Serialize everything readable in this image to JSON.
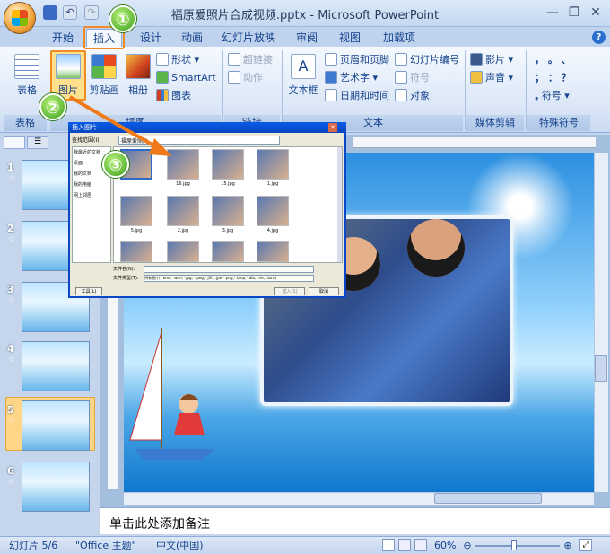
{
  "window": {
    "title": "福原爱照片合成视频.pptx - Microsoft PowerPoint",
    "min": "—",
    "max": "❐",
    "close": "✕"
  },
  "tabs": [
    "开始",
    "插入",
    "设计",
    "动画",
    "幻灯片放映",
    "审阅",
    "视图",
    "加载项"
  ],
  "ribbon": {
    "table": "表格",
    "picture": "图片",
    "clipart": "剪贴画",
    "album": "相册",
    "shapes": "形状",
    "smartart": "SmartArt",
    "chart": "图表",
    "hyperlink": "超链接",
    "action": "动作",
    "textbox": "文本框",
    "headerfooter": "页眉和页脚",
    "wordart": "艺术字",
    "datetime": "日期和时间",
    "slidenum": "幻灯片编号",
    "symbol": "符号",
    "object": "对象",
    "movie": "影片",
    "sound": "声音",
    "special_symbol": "符号",
    "punct1": "，  。  、",
    "punct2": "；  ：  ？",
    "groups": {
      "tables": "表格",
      "illustrations": "插图",
      "links": "链接",
      "text": "文本",
      "media": "媒体剪辑",
      "special": "特殊符号"
    }
  },
  "callouts": [
    "①",
    "②",
    "③"
  ],
  "dialog": {
    "title": "插入图片",
    "lookin_label": "查找范围(I):",
    "lookin_value": "福原爱照片",
    "places": [
      "我最近的文档",
      "桌面",
      "我的文档",
      "我的电脑",
      "网上邻居"
    ],
    "files": [
      "",
      "16.jpg",
      "15.jpg",
      "1.jpg",
      "5.jpg",
      "2.jpg",
      "3.jpg",
      "4.jpg",
      "",
      "",
      "",
      ""
    ],
    "filename_label": "文件名(N):",
    "filetype_label": "文件类型(T):",
    "filetype_value": "所有图片(*.emf;*.wmf;*.jpg;*.jpeg;*.jfif;*.jpe;*.png;*.bmp;*.dib;*.rle;*.bmz)",
    "tools": "工具(L)",
    "insert": "插入(S)",
    "cancel": "取消"
  },
  "slides": [
    "1",
    "2",
    "3",
    "4",
    "5",
    "6"
  ],
  "notes_placeholder": "单击此处添加备注",
  "status": {
    "slide": "幻灯片 5/6",
    "theme": "\"Office 主题\"",
    "lang": "中文(中国)",
    "zoom": "60%"
  },
  "colors": {
    "accent": "#15428b",
    "callout": "#3aa01a",
    "highlight": "#f5a623"
  }
}
